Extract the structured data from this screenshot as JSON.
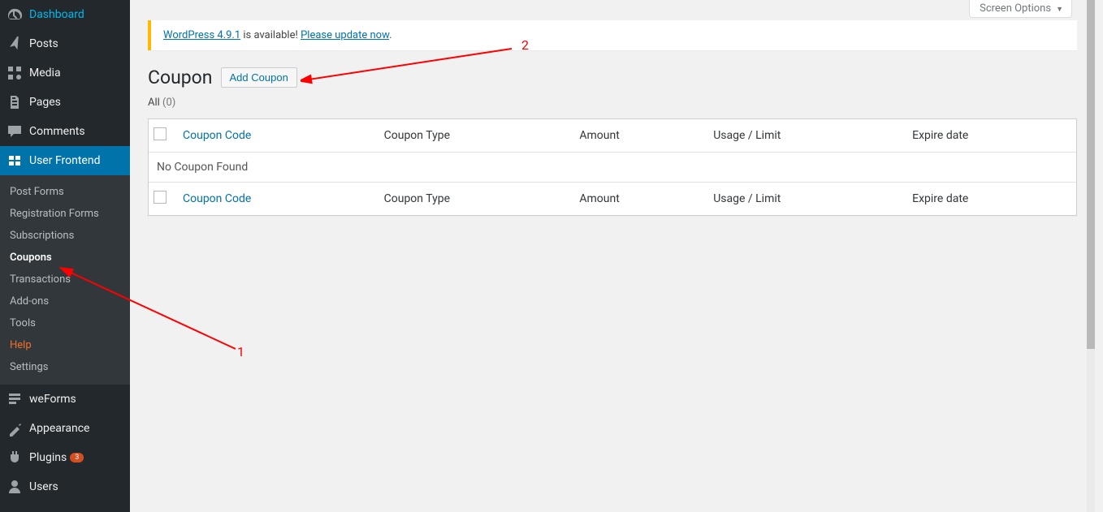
{
  "sidebar": {
    "items": [
      {
        "label": "Dashboard",
        "icon": "dashboard"
      },
      {
        "label": "Posts",
        "icon": "posts"
      },
      {
        "label": "Media",
        "icon": "media"
      },
      {
        "label": "Pages",
        "icon": "pages"
      },
      {
        "label": "Comments",
        "icon": "comments"
      },
      {
        "label": "User Frontend",
        "icon": "uf",
        "current": true
      },
      {
        "label": "weForms",
        "icon": "forms"
      },
      {
        "label": "Appearance",
        "icon": "appearance"
      },
      {
        "label": "Plugins",
        "icon": "plugins",
        "badge": "3"
      },
      {
        "label": "Users",
        "icon": "users"
      }
    ],
    "submenu": [
      {
        "label": "Post Forms"
      },
      {
        "label": "Registration Forms"
      },
      {
        "label": "Subscriptions"
      },
      {
        "label": "Coupons",
        "current": true
      },
      {
        "label": "Transactions"
      },
      {
        "label": "Add-ons"
      },
      {
        "label": "Tools"
      },
      {
        "label": "Help",
        "highlight": true
      },
      {
        "label": "Settings"
      }
    ]
  },
  "screen_options": "Screen Options",
  "notice": {
    "link1": "WordPress 4.9.1",
    "text1": " is available! ",
    "link2": "Please update now",
    "period": "."
  },
  "page": {
    "title": "Coupon",
    "action": "Add Coupon"
  },
  "filter": {
    "label": "All",
    "count": "(0)"
  },
  "table": {
    "cols": [
      "Coupon Code",
      "Coupon Type",
      "Amount",
      "Usage / Limit",
      "Expire date"
    ],
    "empty": "No Coupon Found"
  },
  "annotations": {
    "n1": "1",
    "n2": "2"
  }
}
